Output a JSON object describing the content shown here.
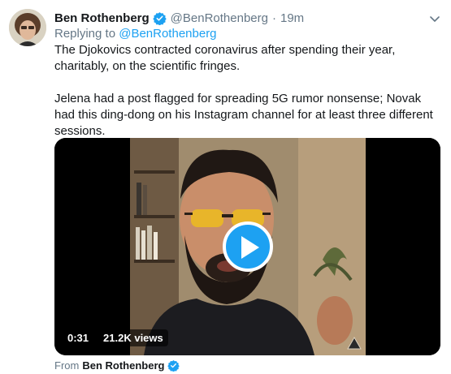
{
  "tweet": {
    "author_name": "Ben Rothenberg",
    "handle": "@BenRothenberg",
    "separator": "·",
    "time": "19m",
    "replying_prefix": "Replying to",
    "replying_handle": "@BenRothenberg",
    "paragraphs": [
      "The Djokovics contracted coronavirus after spending their year, charitably, on the scientific fringes.",
      "Jelena had a post flagged for spreading 5G rumor nonsense; Novak had this ding-dong on his Instagram channel for at least three different sessions."
    ]
  },
  "video": {
    "duration": "0:31",
    "views": "21.2K views"
  },
  "source": {
    "prefix": "From",
    "name": "Ben Rothenberg"
  },
  "colors": {
    "accent": "#1da1f2",
    "secondary_text": "#657786",
    "primary_text": "#14171a"
  },
  "icons": {
    "verified": "verified-badge-icon",
    "caret": "chevron-down-icon",
    "play": "play-icon"
  }
}
